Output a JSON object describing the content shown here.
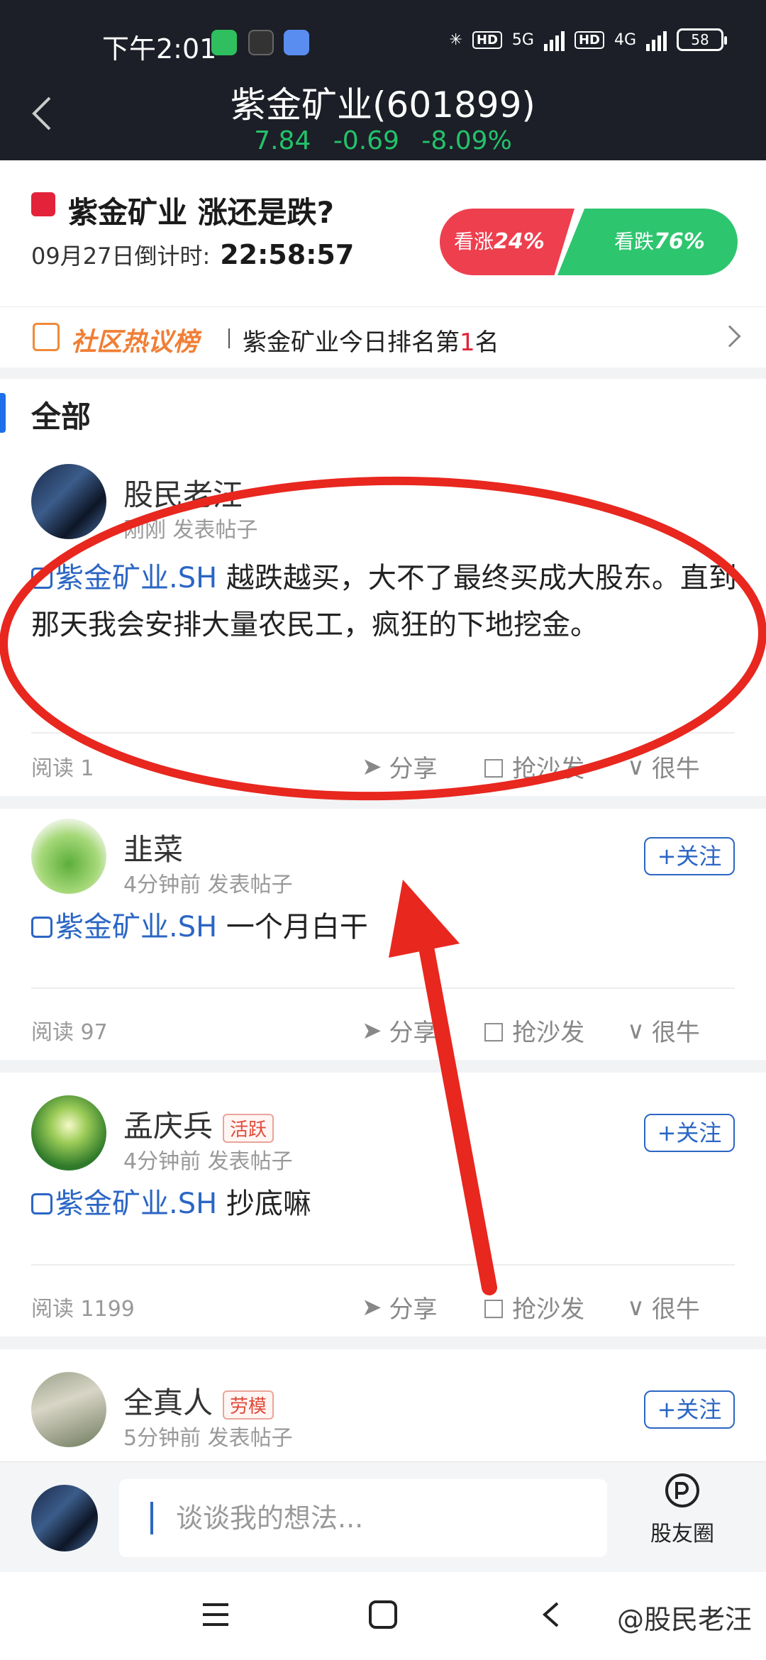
{
  "status_bar": {
    "time": "下午2:01",
    "net1": "5G",
    "net2": "4G",
    "hd": "HD",
    "battery": "58"
  },
  "header": {
    "title": "紫金矿业(601899)",
    "price": "7.84",
    "change": "-0.69",
    "change_pct": "-8.09%"
  },
  "vote": {
    "question": "紫金矿业 涨还是跌?",
    "countdown_label": "09月27日倒计时:",
    "countdown": "22:58:57",
    "bull_label": "看涨",
    "bull_pct": "24%",
    "bear_label": "看跌",
    "bear_pct": "76%"
  },
  "hot": {
    "label": "社区热议榜",
    "rank_prefix": "紫金矿业今日排名第",
    "rank_num": "1",
    "rank_suffix": "名"
  },
  "feed": {
    "tab": "全部",
    "posts": [
      {
        "name": "股民老汪",
        "meta": "刚刚 发表帖子",
        "tag": "紫金矿业.SH",
        "text": " 越跌越买，大不了最终买成大股东。直到那天我会安排大量农民工，疯狂的下地挖金。",
        "read": "阅读 1",
        "share": "分享",
        "sofa": "抢沙发",
        "bull": "很牛"
      },
      {
        "name": "韭菜",
        "meta": "4分钟前 发表帖子",
        "follow": "+关注",
        "tag": "紫金矿业.SH",
        "text": " 一个月白干",
        "read": "阅读 97",
        "share": "分享",
        "sofa": "抢沙发",
        "bull": "很牛"
      },
      {
        "name": "孟庆兵",
        "badge": "活跃",
        "meta": "4分钟前 发表帖子",
        "follow": "+关注",
        "tag": "紫金矿业.SH",
        "text": " 抄底嘛",
        "read": "阅读 1199",
        "share": "分享",
        "sofa": "抢沙发",
        "bull": "很牛"
      },
      {
        "name": "全真人",
        "badge": "劳模",
        "meta": "5分钟前 发表帖子",
        "follow": "+关注"
      }
    ]
  },
  "compose": {
    "placeholder": "谈谈我的想法...",
    "circle_label": "股友圈"
  },
  "watermark": "@股民老汪",
  "colors": {
    "header_bg": "#1c1f27",
    "down_green": "#23c26b",
    "bull_red": "#ee3f4f",
    "bear_green": "#2ec56f",
    "link_blue": "#2b66c4",
    "annotation_red": "#e8271f"
  }
}
